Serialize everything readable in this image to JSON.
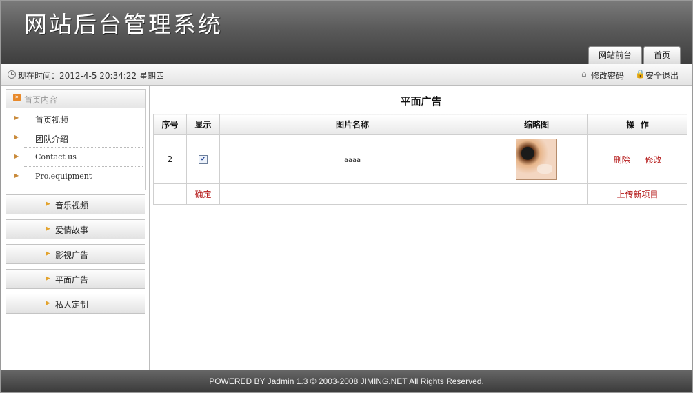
{
  "header": {
    "title": "网站后台管理系统",
    "tabs": [
      "网站前台",
      "首页"
    ]
  },
  "status": {
    "time_label": "现在时间：2012-4-5 20:34:22 星期四",
    "change_password": "修改密码",
    "logout": "安全退出"
  },
  "sidebar": {
    "section_title": "首页内容",
    "sub_items": [
      "首页视频",
      "团队介绍",
      "Contact us",
      "Pro.equipment"
    ],
    "nav_items": [
      "音乐视频",
      "爱情故事",
      "影视广告",
      "平面广告",
      "私人定制"
    ]
  },
  "main": {
    "title": "平面广告",
    "columns": [
      "序号",
      "显示",
      "图片名称",
      "缩略图",
      "操  作"
    ],
    "rows": [
      {
        "id": "2",
        "shown": true,
        "name": "aaaa",
        "delete": "删除",
        "edit": "修改"
      }
    ],
    "confirm": "确定",
    "upload": "上传新项目"
  },
  "footer": {
    "text": "POWERED BY Jadmin 1.3 © 2003-2008 JIMING.NET All Rights Reserved."
  },
  "colors": {
    "accent_red": "#b51a1a",
    "header_gray": "#5a5a5a",
    "menu_icon_orange": "#e8892a"
  }
}
